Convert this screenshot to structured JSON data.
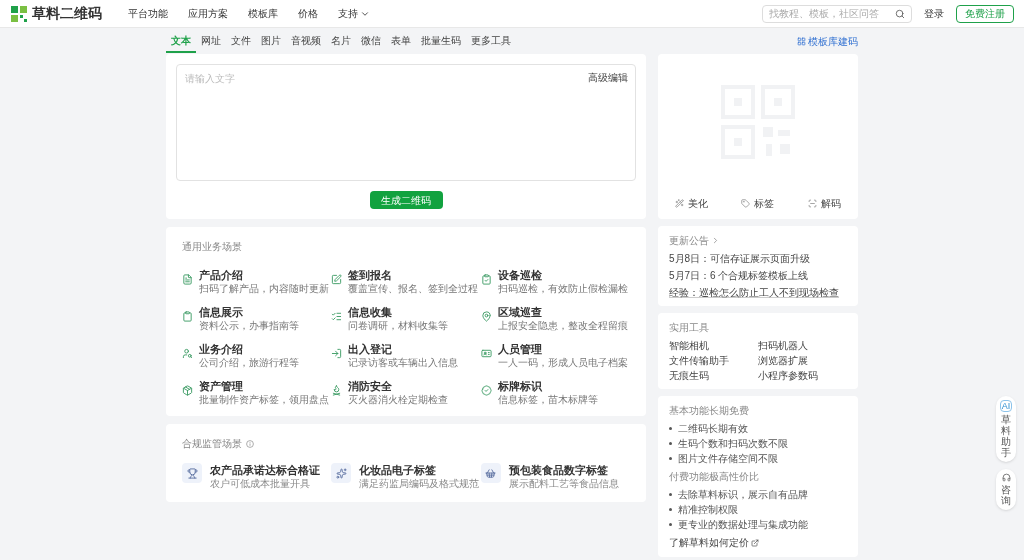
{
  "header": {
    "logo": "草料二维码",
    "nav": [
      {
        "label": "平台功能",
        "dropdown": false
      },
      {
        "label": "应用方案",
        "dropdown": false
      },
      {
        "label": "模板库",
        "dropdown": false
      },
      {
        "label": "价格",
        "dropdown": false
      },
      {
        "label": "支持",
        "dropdown": true
      }
    ],
    "search": {
      "placeholder": "找教程、模板，社区问答"
    },
    "login": "登录",
    "register": "免费注册"
  },
  "tabs": [
    {
      "label": "文本",
      "selected": true
    },
    {
      "label": "网址",
      "selected": false
    },
    {
      "label": "文件",
      "selected": false
    },
    {
      "label": "图片",
      "selected": false
    },
    {
      "label": "音视频",
      "selected": false
    },
    {
      "label": "名片",
      "selected": false
    },
    {
      "label": "微信",
      "selected": false
    },
    {
      "label": "表单",
      "selected": false
    },
    {
      "label": "批量生码",
      "selected": false
    },
    {
      "label": "更多工具",
      "selected": false
    }
  ],
  "template_link": "模板库建码",
  "editor": {
    "placeholder": "请输入文字",
    "advanced": "高级编辑",
    "generate": "生成二维码"
  },
  "preview": {
    "actions": [
      "美化",
      "标签",
      "解码"
    ]
  },
  "general_scenarios": {
    "title": "通用业务场景",
    "items": [
      {
        "title": "产品介绍",
        "desc": "扫码了解产品，内容随时更新"
      },
      {
        "title": "签到报名",
        "desc": "覆盖宣传、报名、签到全过程"
      },
      {
        "title": "设备巡检",
        "desc": "扫码巡检，有效防止假检漏检"
      },
      {
        "title": "信息展示",
        "desc": "资料公示，办事指南等"
      },
      {
        "title": "信息收集",
        "desc": "问卷调研，材料收集等"
      },
      {
        "title": "区域巡查",
        "desc": "上报安全隐患，整改全程留痕"
      },
      {
        "title": "业务介绍",
        "desc": "公司介绍，旅游行程等"
      },
      {
        "title": "出入登记",
        "desc": "记录访客或车辆出入信息"
      },
      {
        "title": "人员管理",
        "desc": "一人一码，形成人员电子档案"
      },
      {
        "title": "资产管理",
        "desc": "批量制作资产标签，领用盘点"
      },
      {
        "title": "消防安全",
        "desc": "灭火器消火栓定期检查"
      },
      {
        "title": "标牌标识",
        "desc": "信息标签，苗木标牌等"
      }
    ]
  },
  "compliance_scenarios": {
    "title": "合规监管场景",
    "items": [
      {
        "title": "农产品承诺达标合格证",
        "desc": "农户可低成本批量开具"
      },
      {
        "title": "化妆品电子标签",
        "desc": "满足药监局编码及格式规范"
      },
      {
        "title": "预包装食品数字标签",
        "desc": "展示配料工艺等食品信息"
      }
    ]
  },
  "announcements": {
    "title": "更新公告",
    "items": [
      "5月8日：可信存证展示页面升级",
      "5月7日：6 个合规标签模板上线",
      "经验：巡检怎么防止工人不到现场检查"
    ]
  },
  "tools": {
    "title": "实用工具",
    "items": [
      "智能相机",
      "扫码机器人",
      "文件传输助手",
      "浏览器扩展",
      "无痕生码",
      "小程序参数码"
    ]
  },
  "features": {
    "free_title": "基本功能长期免费",
    "free_items": [
      "二维码长期有效",
      "生码个数和扫码次数不限",
      "图片文件存储空间不限"
    ],
    "paid_title": "付费功能极高性价比",
    "paid_items": [
      "去除草料标识，展示自有品牌",
      "精准控制权限",
      "更专业的数据处理与集成功能"
    ],
    "pricing_link": "了解草料如何定价"
  },
  "floating": {
    "assistant_badge": "AI",
    "assistant": "草料助手",
    "consult": "咨询"
  }
}
